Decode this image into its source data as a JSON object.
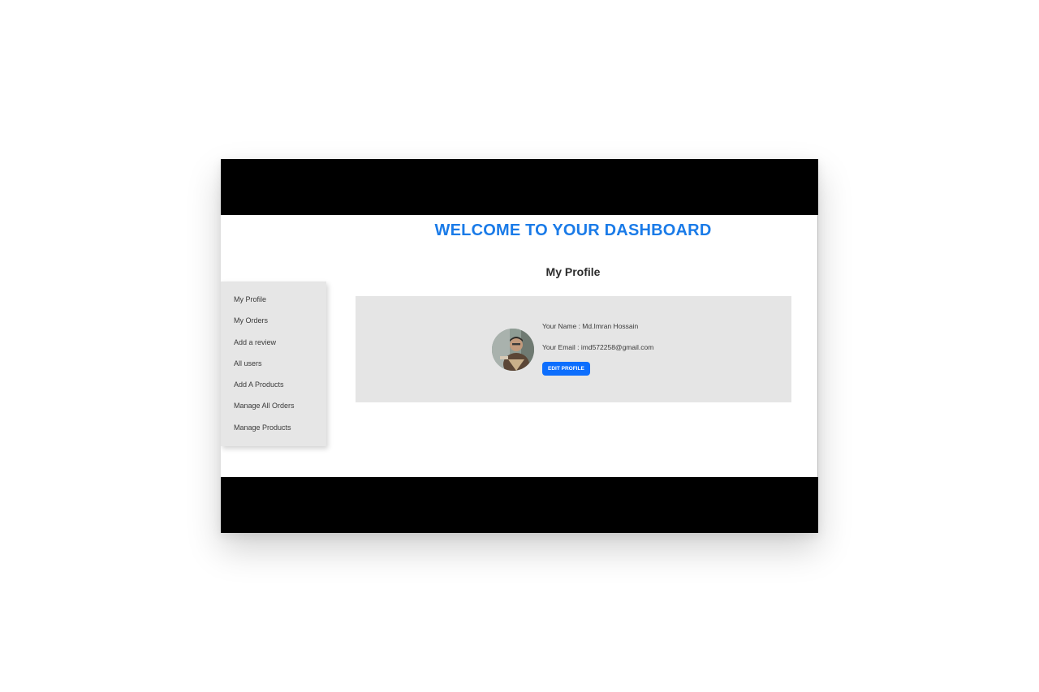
{
  "header": {
    "title": "WELCOME TO YOUR DASHBOARD"
  },
  "sidebar": {
    "items": [
      {
        "label": "My Profile"
      },
      {
        "label": "My Orders"
      },
      {
        "label": "Add a review"
      },
      {
        "label": "All users"
      },
      {
        "label": "Add A Products"
      },
      {
        "label": "Manage All Orders"
      },
      {
        "label": "Manage Products"
      }
    ]
  },
  "profile": {
    "section_title": "My Profile",
    "name_label": "Your Name : ",
    "name": "Md.Imran Hossain",
    "email_label": "Your Email : ",
    "email": "imd572258@gmail.com",
    "edit_button": "EDIT PROFILE",
    "avatar_icon": "user-photo"
  },
  "colors": {
    "accent": "#1a7be8",
    "button": "#0d6efd",
    "panel": "#e5e5e5",
    "letterbox": "#000000"
  }
}
